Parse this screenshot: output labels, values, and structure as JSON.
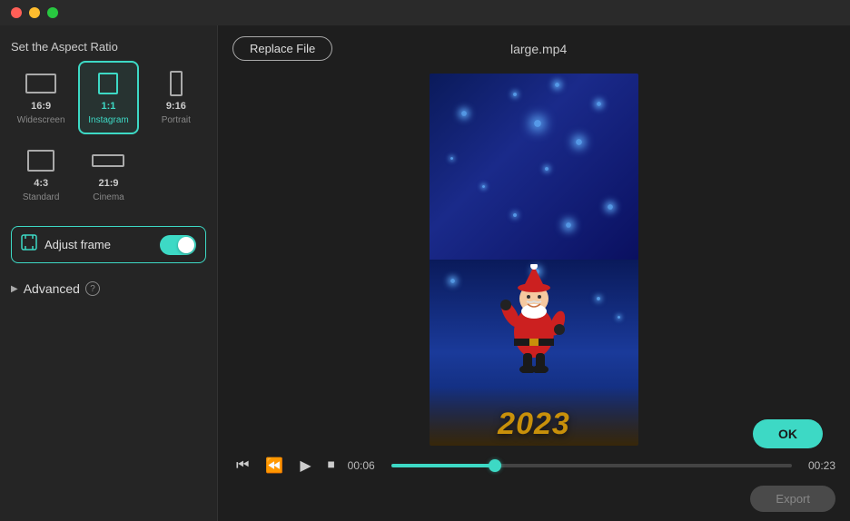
{
  "titleBar": {
    "trafficLights": [
      "close",
      "minimize",
      "maximize"
    ]
  },
  "leftPanel": {
    "sectionTitle": "Set the Aspect Ratio",
    "aspectRatios": [
      {
        "id": "16:9",
        "label": "16:9",
        "sub": "Widescreen",
        "active": false,
        "iconW": 36,
        "iconH": 22
      },
      {
        "id": "1:1",
        "label": "1:1",
        "sub": "Instagram",
        "active": true,
        "iconW": 26,
        "iconH": 26
      },
      {
        "id": "9:16",
        "label": "9:16",
        "sub": "Portrait",
        "active": false,
        "iconW": 18,
        "iconH": 30
      },
      {
        "id": "4:3",
        "label": "4:3",
        "sub": "Standard",
        "active": false,
        "iconW": 32,
        "iconH": 26
      },
      {
        "id": "21:9",
        "label": "21:9",
        "sub": "Cinema",
        "active": false,
        "iconW": 42,
        "iconH": 18
      }
    ],
    "adjustFrame": {
      "label": "Adjust frame",
      "enabled": true
    },
    "advanced": {
      "label": "Advanced",
      "helpTooltip": "?"
    }
  },
  "rightPanel": {
    "replaceFileBtn": "Replace File",
    "fileName": "large.mp4",
    "okBtn": "OK",
    "exportBtn": "Export",
    "controls": {
      "currentTime": "00:06",
      "totalTime": "00:23",
      "progressPercent": 26
    }
  }
}
